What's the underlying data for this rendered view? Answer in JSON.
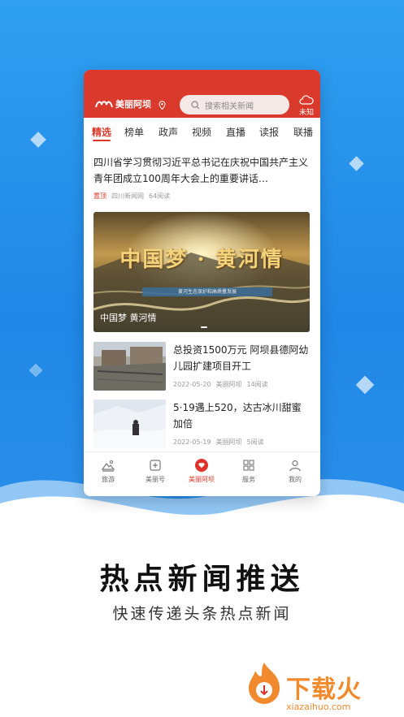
{
  "app": {
    "name": "美丽阿坝",
    "search_placeholder": "搜索相关新闻",
    "weather_label": "未知"
  },
  "tabs": [
    {
      "label": "精选",
      "active": true
    },
    {
      "label": "榜单"
    },
    {
      "label": "政声"
    },
    {
      "label": "视频"
    },
    {
      "label": "直播"
    },
    {
      "label": "读报"
    },
    {
      "label": "联播"
    }
  ],
  "headline": {
    "title": "四川省学习贯彻习近平总书记在庆祝中国共产主义青年团成立100周年大会上的重要讲话…",
    "tag": "置顶",
    "source": "四川新闻网",
    "reads": "64阅读"
  },
  "banner": {
    "image_text": "中国梦 · 黄河情",
    "image_subtext": "黄河生态保护和高质量发展",
    "caption": "中国梦 黄河情"
  },
  "news": [
    {
      "title": "总投资1500万元 阿坝县德阿幼儿园扩建项目开工",
      "date": "2022-05-20",
      "source": "美丽阿坝",
      "reads": "14阅读"
    },
    {
      "title": "5·19遇上520，达古冰川甜蜜加倍",
      "date": "2022-05-19",
      "source": "美丽阿坝",
      "reads": "5阅读"
    }
  ],
  "bottom_nav": [
    {
      "label": "旅游",
      "icon": "mountain-icon"
    },
    {
      "label": "美丽号",
      "icon": "add-square-icon"
    },
    {
      "label": "美丽阿坝",
      "icon": "heart-icon",
      "active": true
    },
    {
      "label": "服务",
      "icon": "grid-icon"
    },
    {
      "label": "我的",
      "icon": "user-icon"
    }
  ],
  "promo": {
    "title": "热点新闻推送",
    "subtitle": "快速传递头条热点新闻"
  },
  "watermark": {
    "brand": "下载火",
    "domain": "xiazaihuo.com"
  },
  "colors": {
    "brand_red": "#d93a2b",
    "background_blue": "#2f9ff0",
    "watermark_orange": "#f08a2c"
  }
}
